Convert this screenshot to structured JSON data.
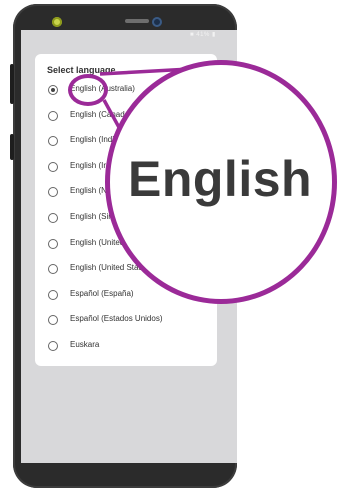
{
  "dialog": {
    "title": "Select language",
    "options": [
      {
        "label": "English (Australia)",
        "selected": true
      },
      {
        "label": "English (Canada)",
        "selected": false
      },
      {
        "label": "English (India)",
        "selected": false
      },
      {
        "label": "English (Ireland)",
        "selected": false
      },
      {
        "label": "English (New Zealand)",
        "selected": false
      },
      {
        "label": "English (Singapore)",
        "selected": false
      },
      {
        "label": "English (United Kingdom)",
        "selected": false
      },
      {
        "label": "English (United States)",
        "selected": false
      },
      {
        "label": "Español (España)",
        "selected": false
      },
      {
        "label": "Español (Estados Unidos)",
        "selected": false
      },
      {
        "label": "Euskara",
        "selected": false
      }
    ]
  },
  "status_bar": {
    "text": "■ 41% ▮"
  },
  "magnifier": {
    "text": "English"
  },
  "colors": {
    "accent": "#9b2a98",
    "dialog": "#ffffff",
    "screen": "#d8d8da",
    "phone": "#2b2b2b"
  }
}
